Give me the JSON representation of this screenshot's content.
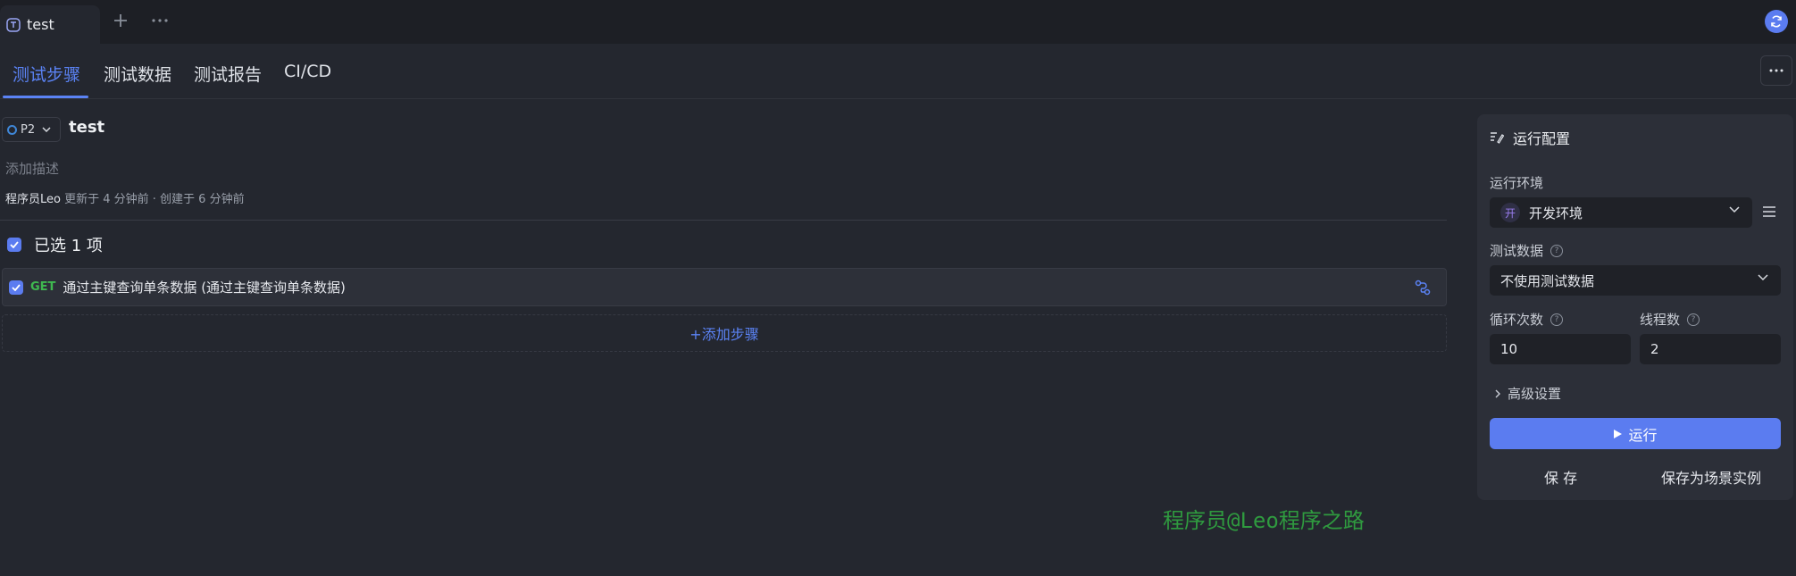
{
  "top_tab": {
    "title": "test"
  },
  "subtabs": [
    {
      "label": "测试步骤",
      "active": true
    },
    {
      "label": "测试数据",
      "active": false
    },
    {
      "label": "测试报告",
      "active": false
    },
    {
      "label": "CI/CD",
      "active": false
    }
  ],
  "scenario": {
    "priority": "P2",
    "name": "test",
    "add_description_placeholder": "添加描述",
    "author": "程序员Leo",
    "meta_text": " 更新于 4 分钟前 · 创建于 6 分钟前"
  },
  "steps": {
    "selected_text": "已选 1 项",
    "items": [
      {
        "method": "GET",
        "name": "通过主键查询单条数据 (通过主键查询单条数据)"
      }
    ],
    "add_step_label": "+添加步骤"
  },
  "run_config": {
    "title": "运行配置",
    "env_label": "运行环境",
    "env_badge": "开",
    "env_value": "开发环境",
    "test_data_label": "测试数据",
    "test_data_value": "不使用测试数据",
    "loop_label": "循环次数",
    "loop_value": "10",
    "thread_label": "线程数",
    "thread_value": "2",
    "advanced_label": "高级设置",
    "run_label": "运行",
    "save_label": "保 存",
    "save_as_label": "保存为场景实例"
  },
  "watermark": "程序员@Leo程序之路",
  "colors": {
    "accent": "#5b83f5",
    "primary_button": "#5b7cf0",
    "method_get": "#3fb950",
    "background": "#24272f",
    "panel": "#2c2f38"
  }
}
